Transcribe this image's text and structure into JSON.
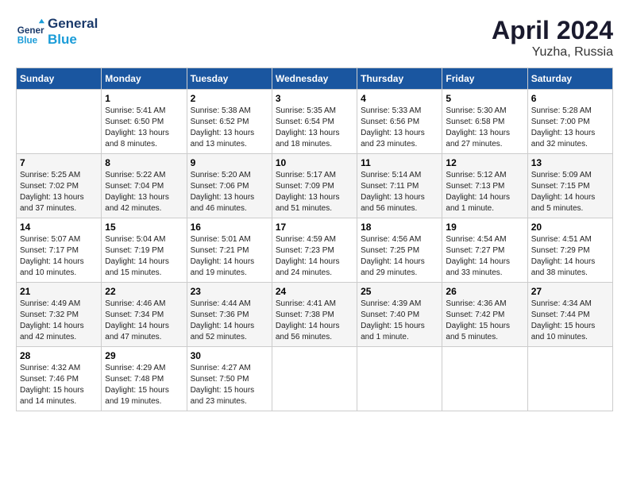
{
  "header": {
    "logo_line1": "General",
    "logo_line2": "Blue",
    "month_year": "April 2024",
    "location": "Yuzha, Russia"
  },
  "weekdays": [
    "Sunday",
    "Monday",
    "Tuesday",
    "Wednesday",
    "Thursday",
    "Friday",
    "Saturday"
  ],
  "weeks": [
    [
      {
        "day": "",
        "sunrise": "",
        "sunset": "",
        "daylight": ""
      },
      {
        "day": "1",
        "sunrise": "Sunrise: 5:41 AM",
        "sunset": "Sunset: 6:50 PM",
        "daylight": "Daylight: 13 hours and 8 minutes."
      },
      {
        "day": "2",
        "sunrise": "Sunrise: 5:38 AM",
        "sunset": "Sunset: 6:52 PM",
        "daylight": "Daylight: 13 hours and 13 minutes."
      },
      {
        "day": "3",
        "sunrise": "Sunrise: 5:35 AM",
        "sunset": "Sunset: 6:54 PM",
        "daylight": "Daylight: 13 hours and 18 minutes."
      },
      {
        "day": "4",
        "sunrise": "Sunrise: 5:33 AM",
        "sunset": "Sunset: 6:56 PM",
        "daylight": "Daylight: 13 hours and 23 minutes."
      },
      {
        "day": "5",
        "sunrise": "Sunrise: 5:30 AM",
        "sunset": "Sunset: 6:58 PM",
        "daylight": "Daylight: 13 hours and 27 minutes."
      },
      {
        "day": "6",
        "sunrise": "Sunrise: 5:28 AM",
        "sunset": "Sunset: 7:00 PM",
        "daylight": "Daylight: 13 hours and 32 minutes."
      }
    ],
    [
      {
        "day": "7",
        "sunrise": "Sunrise: 5:25 AM",
        "sunset": "Sunset: 7:02 PM",
        "daylight": "Daylight: 13 hours and 37 minutes."
      },
      {
        "day": "8",
        "sunrise": "Sunrise: 5:22 AM",
        "sunset": "Sunset: 7:04 PM",
        "daylight": "Daylight: 13 hours and 42 minutes."
      },
      {
        "day": "9",
        "sunrise": "Sunrise: 5:20 AM",
        "sunset": "Sunset: 7:06 PM",
        "daylight": "Daylight: 13 hours and 46 minutes."
      },
      {
        "day": "10",
        "sunrise": "Sunrise: 5:17 AM",
        "sunset": "Sunset: 7:09 PM",
        "daylight": "Daylight: 13 hours and 51 minutes."
      },
      {
        "day": "11",
        "sunrise": "Sunrise: 5:14 AM",
        "sunset": "Sunset: 7:11 PM",
        "daylight": "Daylight: 13 hours and 56 minutes."
      },
      {
        "day": "12",
        "sunrise": "Sunrise: 5:12 AM",
        "sunset": "Sunset: 7:13 PM",
        "daylight": "Daylight: 14 hours and 1 minute."
      },
      {
        "day": "13",
        "sunrise": "Sunrise: 5:09 AM",
        "sunset": "Sunset: 7:15 PM",
        "daylight": "Daylight: 14 hours and 5 minutes."
      }
    ],
    [
      {
        "day": "14",
        "sunrise": "Sunrise: 5:07 AM",
        "sunset": "Sunset: 7:17 PM",
        "daylight": "Daylight: 14 hours and 10 minutes."
      },
      {
        "day": "15",
        "sunrise": "Sunrise: 5:04 AM",
        "sunset": "Sunset: 7:19 PM",
        "daylight": "Daylight: 14 hours and 15 minutes."
      },
      {
        "day": "16",
        "sunrise": "Sunrise: 5:01 AM",
        "sunset": "Sunset: 7:21 PM",
        "daylight": "Daylight: 14 hours and 19 minutes."
      },
      {
        "day": "17",
        "sunrise": "Sunrise: 4:59 AM",
        "sunset": "Sunset: 7:23 PM",
        "daylight": "Daylight: 14 hours and 24 minutes."
      },
      {
        "day": "18",
        "sunrise": "Sunrise: 4:56 AM",
        "sunset": "Sunset: 7:25 PM",
        "daylight": "Daylight: 14 hours and 29 minutes."
      },
      {
        "day": "19",
        "sunrise": "Sunrise: 4:54 AM",
        "sunset": "Sunset: 7:27 PM",
        "daylight": "Daylight: 14 hours and 33 minutes."
      },
      {
        "day": "20",
        "sunrise": "Sunrise: 4:51 AM",
        "sunset": "Sunset: 7:29 PM",
        "daylight": "Daylight: 14 hours and 38 minutes."
      }
    ],
    [
      {
        "day": "21",
        "sunrise": "Sunrise: 4:49 AM",
        "sunset": "Sunset: 7:32 PM",
        "daylight": "Daylight: 14 hours and 42 minutes."
      },
      {
        "day": "22",
        "sunrise": "Sunrise: 4:46 AM",
        "sunset": "Sunset: 7:34 PM",
        "daylight": "Daylight: 14 hours and 47 minutes."
      },
      {
        "day": "23",
        "sunrise": "Sunrise: 4:44 AM",
        "sunset": "Sunset: 7:36 PM",
        "daylight": "Daylight: 14 hours and 52 minutes."
      },
      {
        "day": "24",
        "sunrise": "Sunrise: 4:41 AM",
        "sunset": "Sunset: 7:38 PM",
        "daylight": "Daylight: 14 hours and 56 minutes."
      },
      {
        "day": "25",
        "sunrise": "Sunrise: 4:39 AM",
        "sunset": "Sunset: 7:40 PM",
        "daylight": "Daylight: 15 hours and 1 minute."
      },
      {
        "day": "26",
        "sunrise": "Sunrise: 4:36 AM",
        "sunset": "Sunset: 7:42 PM",
        "daylight": "Daylight: 15 hours and 5 minutes."
      },
      {
        "day": "27",
        "sunrise": "Sunrise: 4:34 AM",
        "sunset": "Sunset: 7:44 PM",
        "daylight": "Daylight: 15 hours and 10 minutes."
      }
    ],
    [
      {
        "day": "28",
        "sunrise": "Sunrise: 4:32 AM",
        "sunset": "Sunset: 7:46 PM",
        "daylight": "Daylight: 15 hours and 14 minutes."
      },
      {
        "day": "29",
        "sunrise": "Sunrise: 4:29 AM",
        "sunset": "Sunset: 7:48 PM",
        "daylight": "Daylight: 15 hours and 19 minutes."
      },
      {
        "day": "30",
        "sunrise": "Sunrise: 4:27 AM",
        "sunset": "Sunset: 7:50 PM",
        "daylight": "Daylight: 15 hours and 23 minutes."
      },
      {
        "day": "",
        "sunrise": "",
        "sunset": "",
        "daylight": ""
      },
      {
        "day": "",
        "sunrise": "",
        "sunset": "",
        "daylight": ""
      },
      {
        "day": "",
        "sunrise": "",
        "sunset": "",
        "daylight": ""
      },
      {
        "day": "",
        "sunrise": "",
        "sunset": "",
        "daylight": ""
      }
    ]
  ]
}
